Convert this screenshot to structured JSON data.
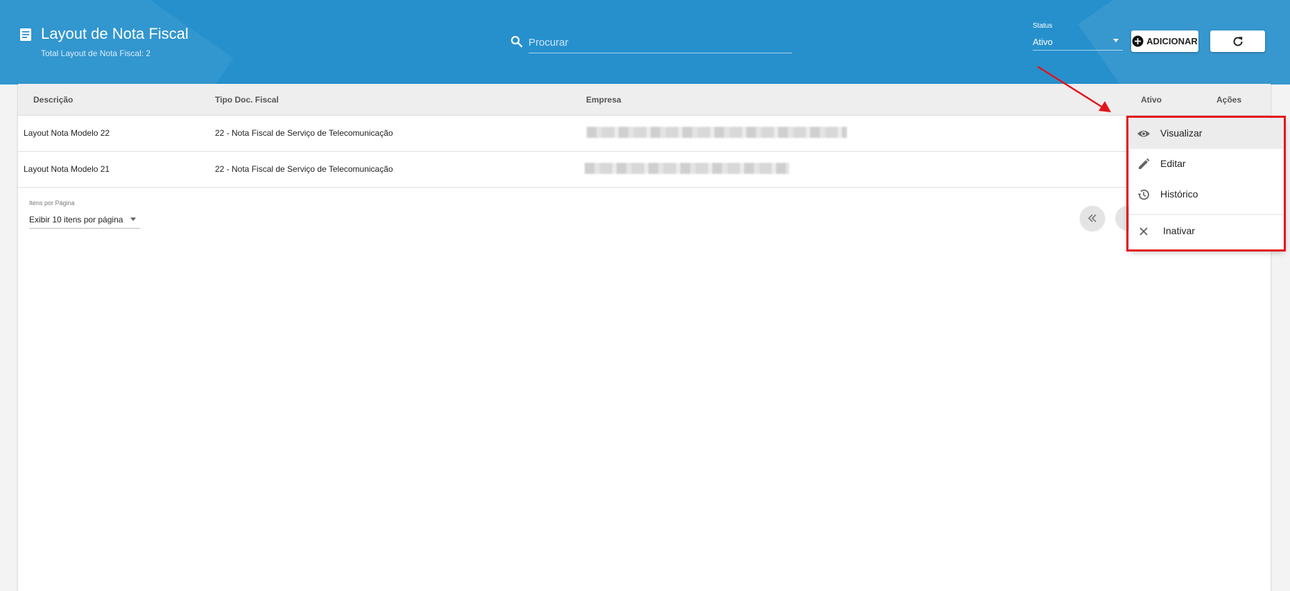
{
  "header": {
    "title": "Layout de Nota Fiscal",
    "subtitle": "Total Layout de Nota Fiscal: 2",
    "search_placeholder": "Procurar",
    "status_label": "Status",
    "status_value": "Ativo",
    "add_label": "ADICIONAR"
  },
  "table": {
    "columns": {
      "descricao": "Descrição",
      "tipo": "Tipo Doc. Fiscal",
      "empresa": "Empresa",
      "ativo": "Ativo",
      "acoes": "Ações"
    },
    "rows": [
      {
        "descricao": "Layout Nota Modelo 22",
        "tipo": "22 - Nota Fiscal de Serviço de Telecomunicação"
      },
      {
        "descricao": "Layout Nota Modelo 21",
        "tipo": "22 - Nota Fiscal de Serviço de Telecomunicação"
      }
    ]
  },
  "pagination": {
    "label": "Itens por Página",
    "value": "Exibir 10 itens por página"
  },
  "menu": {
    "items": [
      {
        "label": "Visualizar",
        "icon": "eye-icon"
      },
      {
        "label": "Editar",
        "icon": "pencil-icon"
      },
      {
        "label": "Histórico",
        "icon": "history-icon"
      },
      {
        "label": "Inativar",
        "icon": "close-icon"
      }
    ]
  },
  "colors": {
    "header_bg": "#2690cd",
    "highlight": "#e3141b"
  }
}
